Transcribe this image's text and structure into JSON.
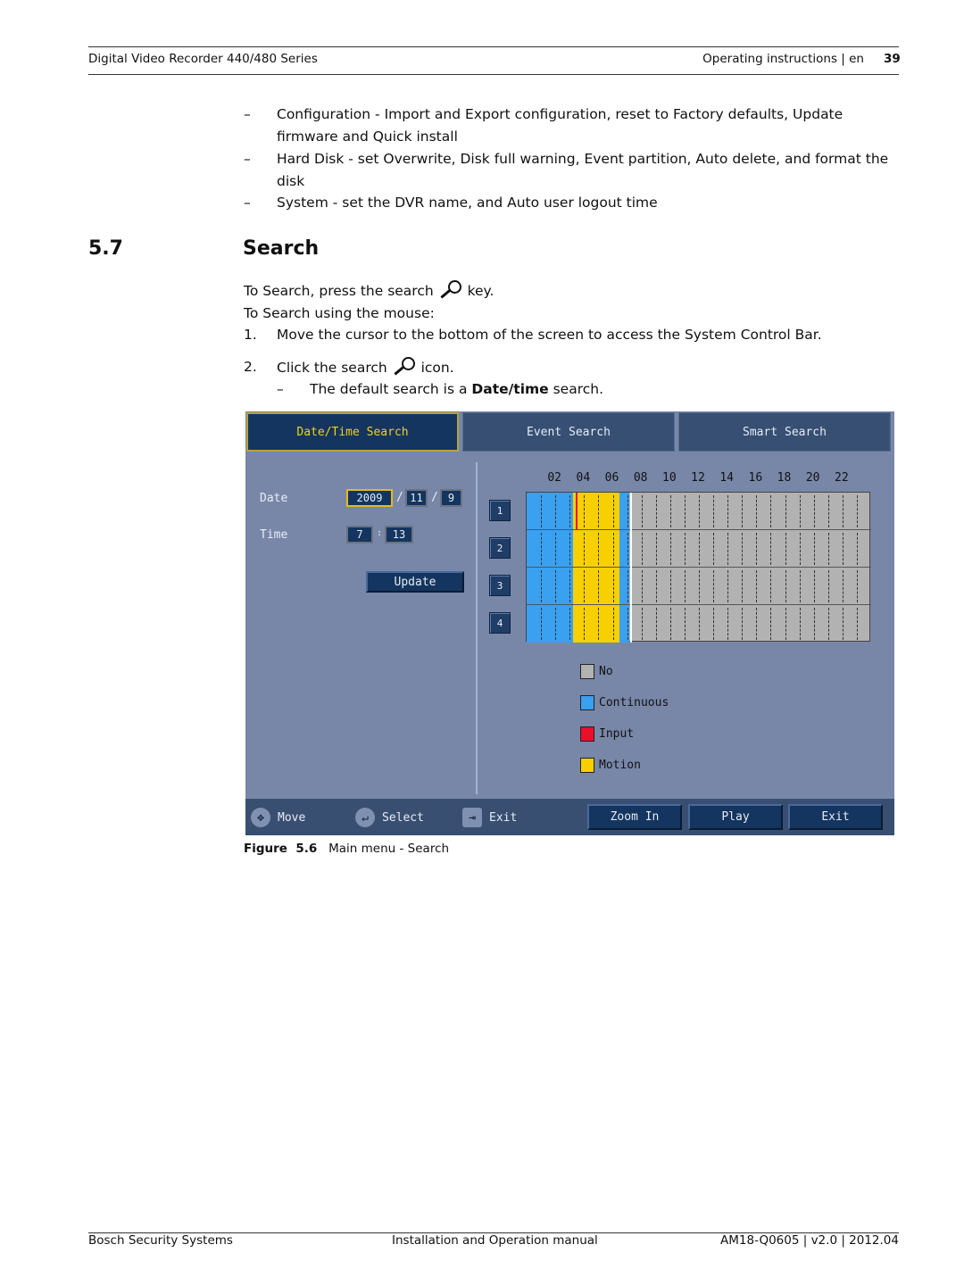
{
  "header": {
    "left": "Digital Video Recorder 440/480 Series",
    "right": "Operating instructions | en",
    "page": "39"
  },
  "bullets": [
    {
      "dash": "–",
      "lines": [
        "Configuration - Import and Export configuration, reset to Factory defaults, Update",
        "firmware and Quick install"
      ]
    },
    {
      "dash": "–",
      "lines": [
        "Hard Disk - set Overwrite, Disk full warning, Event partition, Auto delete, and format the",
        "disk"
      ]
    },
    {
      "dash": "–",
      "lines": [
        "System - set the DVR name, and Auto user logout time"
      ]
    }
  ],
  "section": {
    "number": "5.7",
    "title": "Search"
  },
  "para": {
    "line1_a": "To Search, press the search",
    "line1_b": "key.",
    "line2": "To Search using the mouse:",
    "step1_num": "1.",
    "step1": "Move the cursor to the bottom of the screen to access the System Control Bar.",
    "step2_num": "2.",
    "step2_a": "Click the search",
    "step2_b": "icon.",
    "sub_dash": "–",
    "sub_a": "The default search is a ",
    "sub_bold": "Date/time",
    "sub_b": " search."
  },
  "dvr": {
    "tabs": [
      "Date/Time Search",
      "Event Search",
      "Smart Search"
    ],
    "active_tab": "Date/Time Search",
    "date_label": "Date",
    "year": "2009",
    "sep1": "/",
    "month": "11",
    "sep2": "/",
    "day": "9",
    "time_label": "Time",
    "hour": "7",
    "time_sep": ":",
    "minute": "13",
    "update": "Update",
    "channels": [
      "1",
      "2",
      "3",
      "4"
    ],
    "hour_ticks": [
      "02",
      "04",
      "06",
      "08",
      "10",
      "12",
      "14",
      "16",
      "18",
      "20",
      "22"
    ],
    "timeline": {
      "hours": 24,
      "cursor_hour": 7.22,
      "segments": [
        {
          "type": "continuous",
          "start": 0,
          "end": 3.25
        },
        {
          "type": "motion",
          "start": 3.25,
          "end": 6.45
        },
        {
          "type": "continuous",
          "start": 6.45,
          "end": 7.15
        }
      ],
      "input_marks": [
        {
          "channel": "1",
          "hour": 3.4
        }
      ]
    },
    "legend": [
      {
        "label": "No",
        "color": "#b2b2b2"
      },
      {
        "label": "Continuous",
        "color": "#3aa0f0"
      },
      {
        "label": "Input",
        "color": "#e8102a"
      },
      {
        "label": "Motion",
        "color": "#f8d000"
      }
    ],
    "hints": {
      "move": "Move",
      "select": "Select",
      "exit": "Exit"
    },
    "buttons": {
      "zoom": "Zoom In",
      "play": "Play",
      "exit": "Exit"
    }
  },
  "caption": {
    "label": "Figure  5.6",
    "text": "Main menu - Search"
  },
  "footer": {
    "left": "Bosch Security Systems",
    "center": "Installation and Operation manual",
    "right": "AM18-Q0605 | v2.0 | 2012.04"
  }
}
